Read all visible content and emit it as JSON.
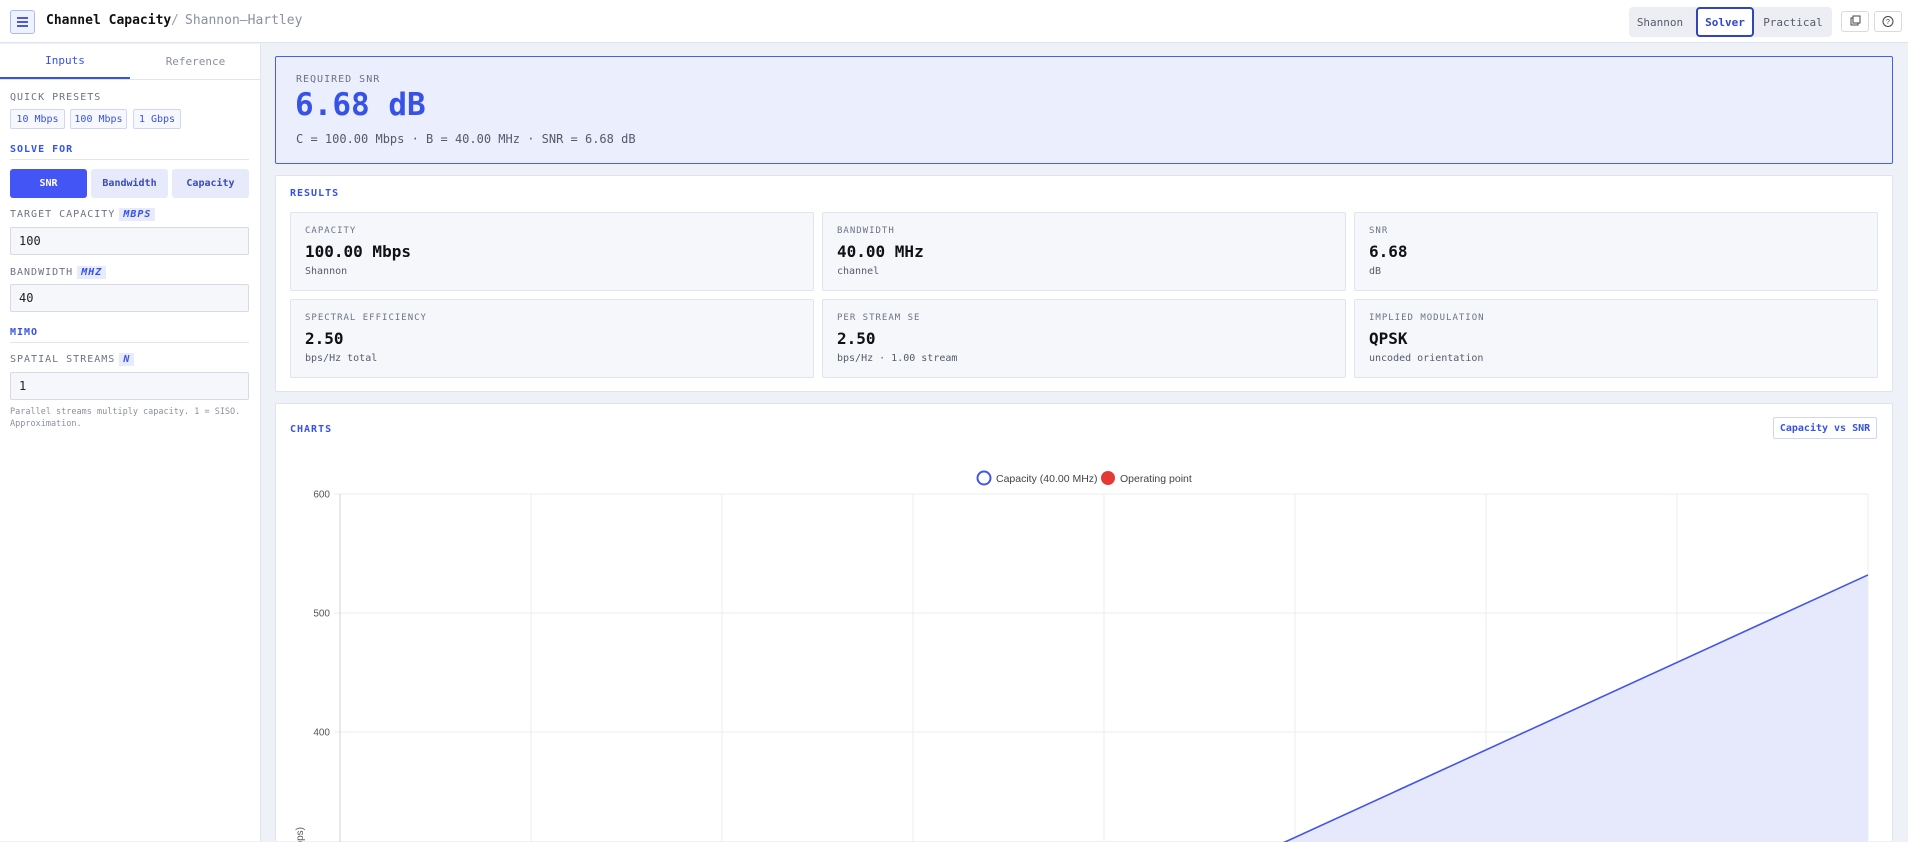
{
  "header": {
    "title": "Channel Capacity",
    "separator": "/",
    "subtitle": "Shannon–Hartley",
    "modes": [
      "Shannon",
      "Solver",
      "Practical"
    ],
    "active_mode": "Solver"
  },
  "sidebar": {
    "tabs": [
      "Inputs",
      "Reference"
    ],
    "quick_presets_label": "QUICK PRESETS",
    "presets": [
      "10 Mbps",
      "100 Mbps",
      "1 Gbps"
    ],
    "solve_for_label": "SOLVE FOR",
    "solve_options": [
      "SNR",
      "Bandwidth",
      "Capacity"
    ],
    "target_capacity_label": "TARGET CAPACITY",
    "target_capacity_unit": "MBPS",
    "target_capacity_value": "100",
    "bandwidth_label": "BANDWIDTH",
    "bandwidth_unit": "MHZ",
    "bandwidth_value": "40",
    "mimo_label": "MIMO",
    "streams_label": "SPATIAL STREAMS",
    "streams_unit": "N",
    "streams_value": "1",
    "note": "Parallel streams multiply capacity. 1 = SISO. Approximation."
  },
  "hero": {
    "label": "REQUIRED SNR",
    "value": "6.68 dB",
    "formula": "C = 100.00 Mbps · B = 40.00 MHz · SNR = 6.68 dB"
  },
  "results": {
    "title": "RESULTS",
    "cards": [
      {
        "label": "CAPACITY",
        "value": "100.00 Mbps",
        "sub": "Shannon"
      },
      {
        "label": "BANDWIDTH",
        "value": "40.00 MHz",
        "sub": "channel"
      },
      {
        "label": "SNR",
        "value": "6.68",
        "sub": "dB"
      },
      {
        "label": "SPECTRAL EFFICIENCY",
        "value": "2.50",
        "sub": "bps/Hz total"
      },
      {
        "label": "PER STREAM SE",
        "value": "2.50",
        "sub": "bps/Hz · 1.00 stream"
      },
      {
        "label": "IMPLIED MODULATION",
        "value": "QPSK",
        "sub": "uncoded orientation"
      }
    ]
  },
  "charts": {
    "title": "CHARTS",
    "button": "Capacity vs SNR"
  },
  "chart_data": {
    "type": "area",
    "ylabel_visible": "Mbps)",
    "legend": [
      "Capacity (40.00 MHz)",
      "Operating point"
    ],
    "legend_position": "top-center",
    "y_ticks": [
      600,
      500,
      400
    ],
    "grid": true,
    "x_visible_fraction_range": [
      0,
      1
    ],
    "series": [
      {
        "name": "Capacity (40.00 MHz)",
        "color": "#4355e8",
        "points_y": [
          [
            0.5716,
            280
          ],
          [
            1.0,
            532
          ]
        ]
      }
    ]
  },
  "colors": {
    "accent": "#3652e8",
    "operating_point": "#e53935"
  }
}
